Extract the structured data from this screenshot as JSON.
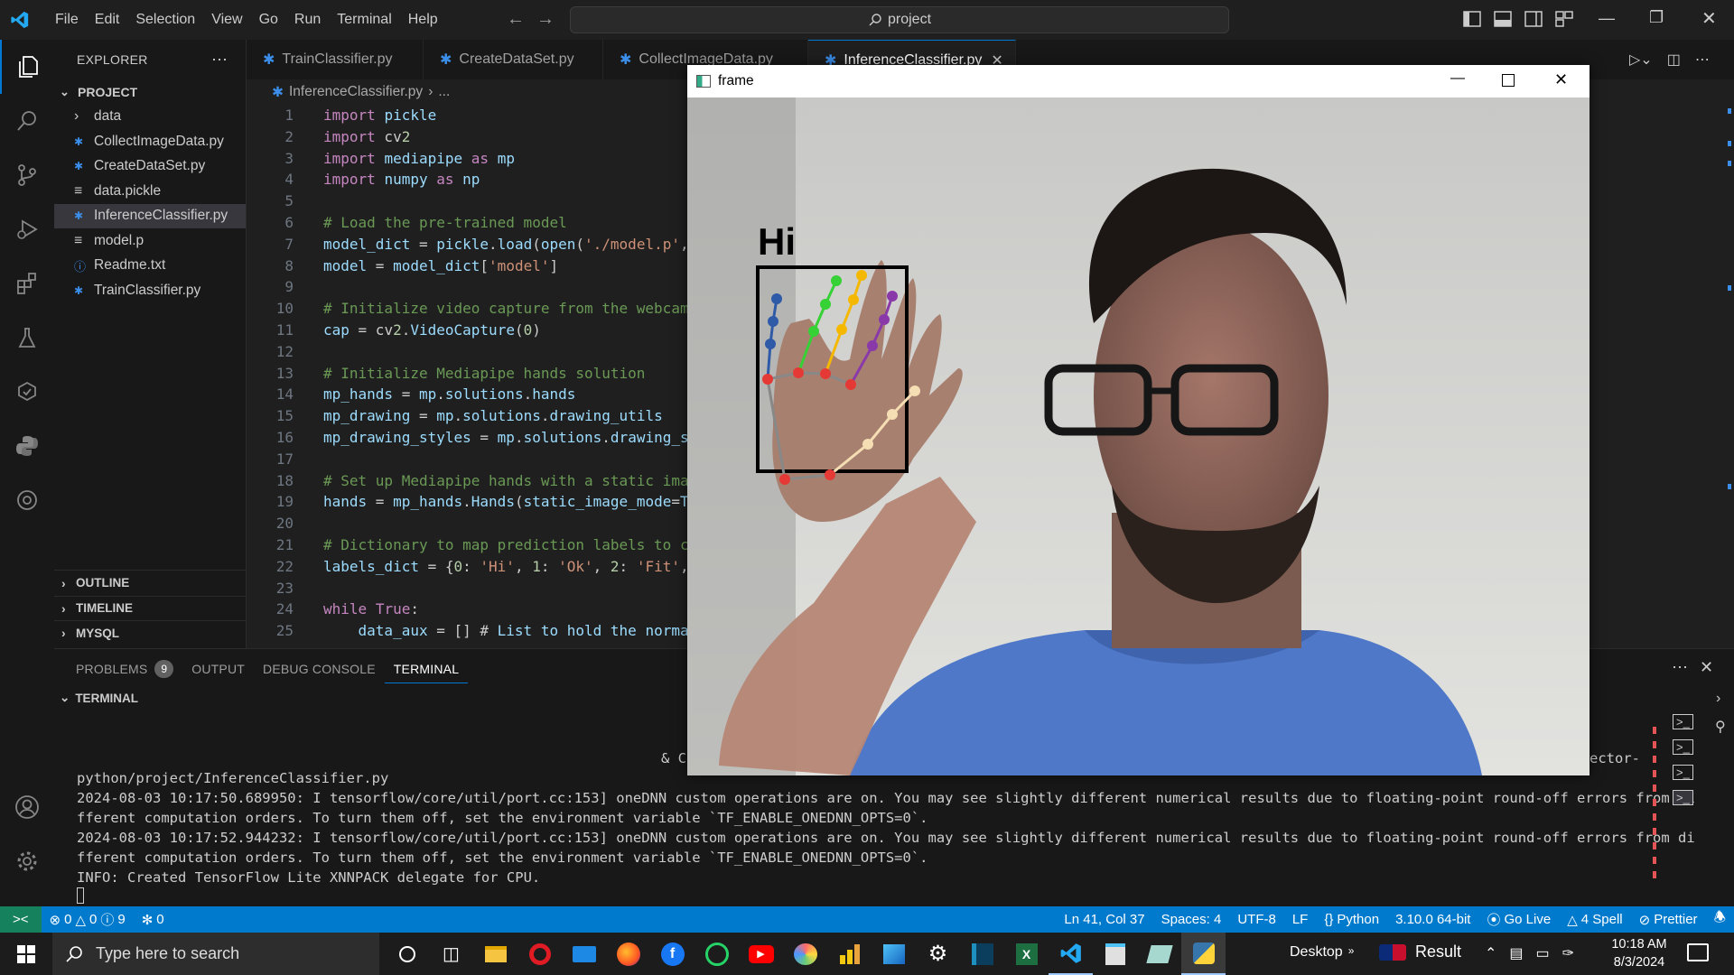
{
  "menu": [
    "File",
    "Edit",
    "Selection",
    "View",
    "Go",
    "Run",
    "Terminal",
    "Help"
  ],
  "command_center": {
    "text": "project"
  },
  "explorer": {
    "title": "EXPLORER",
    "project_label": "PROJECT",
    "items": [
      {
        "label": "data",
        "kind": "folder"
      },
      {
        "label": "CollectImageData.py",
        "kind": "python"
      },
      {
        "label": "CreateDataSet.py",
        "kind": "python"
      },
      {
        "label": "data.pickle",
        "kind": "file"
      },
      {
        "label": "InferenceClassifier.py",
        "kind": "python",
        "selected": true
      },
      {
        "label": "model.p",
        "kind": "file"
      },
      {
        "label": "Readme.txt",
        "kind": "info"
      },
      {
        "label": "TrainClassifier.py",
        "kind": "python"
      }
    ],
    "sections": [
      "OUTLINE",
      "TIMELINE",
      "MYSQL"
    ]
  },
  "tabs": [
    {
      "label": "TrainClassifier.py",
      "active": false
    },
    {
      "label": "CreateDataSet.py",
      "active": false
    },
    {
      "label": "CollectImageData.py",
      "active": false
    },
    {
      "label": "InferenceClassifier.py",
      "active": true
    }
  ],
  "breadcrumb": {
    "file": "InferenceClassifier.py",
    "rest": "..."
  },
  "code": [
    {
      "n": "1",
      "t": "import pickle"
    },
    {
      "n": "2",
      "t": "import cv2"
    },
    {
      "n": "3",
      "t": "import mediapipe as mp"
    },
    {
      "n": "4",
      "t": "import numpy as np"
    },
    {
      "n": "5",
      "t": ""
    },
    {
      "n": "6",
      "t": "# Load the pre-trained model"
    },
    {
      "n": "7",
      "t": "model_dict = pickle.load(open('./model.p',"
    },
    {
      "n": "8",
      "t": "model = model_dict['model']"
    },
    {
      "n": "9",
      "t": ""
    },
    {
      "n": "10",
      "t": "# Initialize video capture from the webcam"
    },
    {
      "n": "11",
      "t": "cap = cv2.VideoCapture(0)"
    },
    {
      "n": "12",
      "t": ""
    },
    {
      "n": "13",
      "t": "# Initialize Mediapipe hands solution"
    },
    {
      "n": "14",
      "t": "mp_hands = mp.solutions.hands"
    },
    {
      "n": "15",
      "t": "mp_drawing = mp.solutions.drawing_utils"
    },
    {
      "n": "16",
      "t": "mp_drawing_styles = mp.solutions.drawing_s"
    },
    {
      "n": "17",
      "t": ""
    },
    {
      "n": "18",
      "t": "# Set up Mediapipe hands with a static ima"
    },
    {
      "n": "19",
      "t": "hands = mp_hands.Hands(static_image_mode=T"
    },
    {
      "n": "20",
      "t": ""
    },
    {
      "n": "21",
      "t": "# Dictionary to map prediction labels to c"
    },
    {
      "n": "22",
      "t": "labels_dict = {0: 'Hi', 1: 'Ok', 2: 'Fit',"
    },
    {
      "n": "23",
      "t": ""
    },
    {
      "n": "24",
      "t": "while True:"
    },
    {
      "n": "25",
      "t": "    data_aux = [] # List to hold the norma"
    }
  ],
  "panel": {
    "tabs": [
      "PROBLEMS",
      "OUTPUT",
      "DEBUG CONSOLE",
      "TERMINAL"
    ],
    "problems_count": "9",
    "terminal_header": "TERMINAL",
    "partial_left": "& C",
    "partial_right": "ector-",
    "lines": [
      "python/project/InferenceClassifier.py",
      "2024-08-03 10:17:50.689950: I tensorflow/core/util/port.cc:153] oneDNN custom operations are on. You may see slightly different numerical results due to floating-point round-off errors from di",
      "fferent computation orders. To turn them off, set the environment variable `TF_ENABLE_ONEDNN_OPTS=0`.",
      "2024-08-03 10:17:52.944232: I tensorflow/core/util/port.cc:153] oneDNN custom operations are on. You may see slightly different numerical results due to floating-point round-off errors from di",
      "fferent computation orders. To turn them off, set the environment variable `TF_ENABLE_ONEDNN_OPTS=0`.",
      "INFO: Created TensorFlow Lite XNNPACK delegate for CPU."
    ]
  },
  "status": {
    "errors": "0",
    "warnings": "0",
    "infos": "9",
    "ports": "0",
    "position": "Ln 41, Col 37",
    "spaces": "Spaces: 4",
    "encoding": "UTF-8",
    "eol": "LF",
    "language": "Python",
    "interpreter": "3.10.0 64-bit",
    "golive": "Go Live",
    "spell": "4 Spell",
    "prettier": "Prettier"
  },
  "frame": {
    "title": "frame",
    "prediction": "Hi"
  },
  "taskbar": {
    "search_placeholder": "Type here to search",
    "desktop": "Desktop",
    "result": "Result",
    "time": "10:18 AM",
    "date": "8/3/2024"
  },
  "colors": {
    "accent": "#0078d4",
    "statusbar": "#007acc",
    "python": "#3b8eea"
  }
}
